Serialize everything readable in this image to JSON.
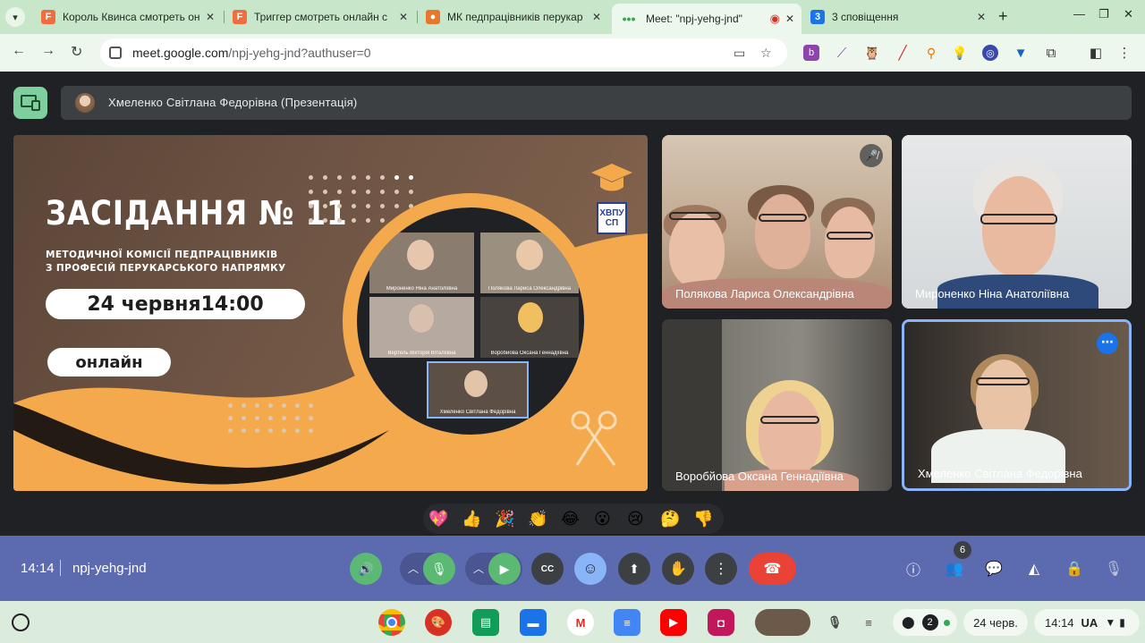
{
  "browser": {
    "tabs": [
      {
        "title": "Король Квинса смотреть он",
        "favicon": "F",
        "color": "#f26d3d"
      },
      {
        "title": "Триггер смотреть онлайн с",
        "favicon": "F",
        "color": "#f26d3d"
      },
      {
        "title": "МК педпрацівників перукар",
        "favicon": "•",
        "color": "#e8762c"
      },
      {
        "title": "Meet: \"npj-yehg-jnd\"",
        "favicon": "•••",
        "color": "#34a853",
        "active": true
      },
      {
        "title": "3 сповіщення",
        "favicon": "3",
        "color": "#1a73e8"
      }
    ],
    "url_host": "meet.google.com",
    "url_path": "/npj-yehg-jnd?authuser=0"
  },
  "meet": {
    "presenter_label": "Хмеленко Світлана Федорівна (Презентація)",
    "slide": {
      "title": "ЗАСІДАННЯ № 11",
      "subtitle": "МЕТОДИЧНОЇ КОМІСІЇ ПЕДПРАЦІВНИКІВ\nЗ ПРОФЕСІЙ ПЕРУКАРСЬКОГО НАПРЯМКУ",
      "date_time": "24 червня14:00",
      "format": "онлайн",
      "logo_text": "ХВПУ СП",
      "inner_captions": [
        "Мироненко Ніна Анатоліївна",
        "Полякова Лариса Олександрівна",
        "Вертель Вікторія Віталіївна",
        "Воробйова Оксана Геннадіївна",
        "Хмеленко Світлана Федорівна"
      ]
    },
    "participants": [
      {
        "name": "Полякова Лариса Олександрівна",
        "muted": true
      },
      {
        "name": "Мироненко Ніна Анатоліївна"
      },
      {
        "name": "Воробйова Оксана Геннадіївна"
      },
      {
        "name": "Хмеленко Світлана Федорівна",
        "active_speaker": true
      }
    ],
    "reactions": [
      "💖",
      "👍",
      "🎉",
      "👏",
      "😂",
      "😮",
      "😢",
      "🤔",
      "👎"
    ],
    "call_bar": {
      "time": "14:14",
      "meeting_code": "npj-yehg-jnd",
      "people_count": "6"
    }
  },
  "shelf": {
    "notification_count": "2",
    "date": "24 черв.",
    "time": "14:14",
    "layout": "UA"
  }
}
